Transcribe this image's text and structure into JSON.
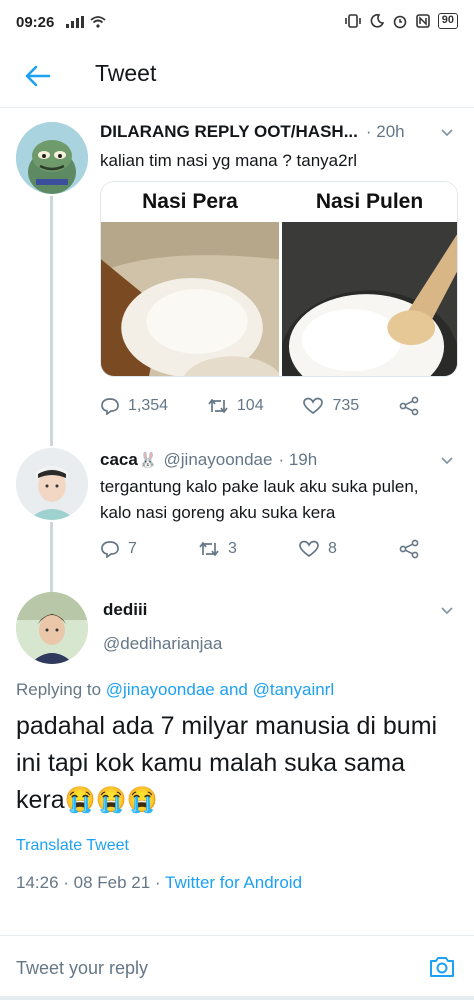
{
  "status_bar": {
    "time": "09:26",
    "battery": "90"
  },
  "header": {
    "title": "Tweet"
  },
  "tweet1": {
    "name": "DILARANG REPLY OOT/HASH...",
    "time": "· 20h",
    "text": "kalian tim nasi yg mana ? tanya2rl",
    "media": {
      "left_label": "Nasi Pera",
      "right_label": "Nasi Pulen"
    },
    "replies": "1,354",
    "retweets": "104",
    "likes": "735"
  },
  "tweet2": {
    "name": "caca",
    "name_emoji": "🐰",
    "handle": "@jinayoondae",
    "time": "· 19h",
    "text": "tergantung kalo pake lauk aku suka pulen, kalo nasi goreng aku suka kera",
    "replies": "7",
    "retweets": "3",
    "likes": "8"
  },
  "main_tweet": {
    "name": "dediii",
    "handle": "@dediharianjaa",
    "replying_prefix": "Replying to",
    "replying_user1": "@jinayoondae",
    "replying_and": "and",
    "replying_user2": "@tanyainrl",
    "text": "padahal ada 7 milyar manusia di bumi ini tapi kok kamu malah suka sama kera😭😭😭",
    "translate": "Translate Tweet",
    "timestamp": "14:26 · 08 Feb 21 ·",
    "source": "Twitter for Android"
  },
  "reply_bar": {
    "placeholder": "Tweet your reply"
  },
  "colors": {
    "accent": "#1da1f2",
    "secondary_text": "#657786",
    "primary_text": "#14171a"
  }
}
